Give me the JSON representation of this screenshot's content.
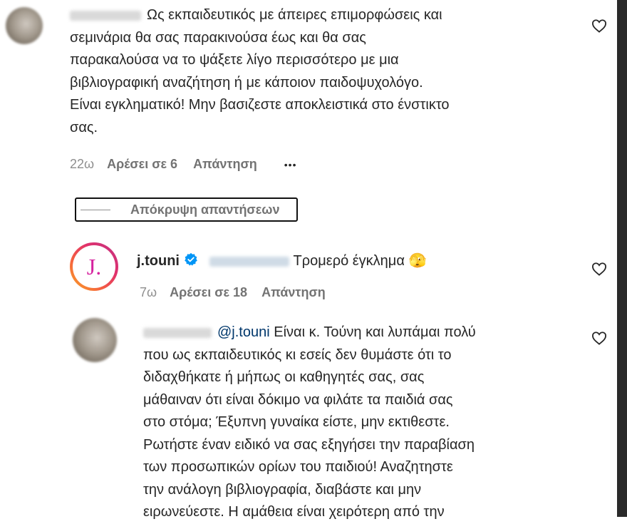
{
  "comment1": {
    "text_lines": [
      "Ως εκπαιδευτικός με άπειρες επιμορφώσεις και",
      "σεμινάρια θα σας παρακινούσα έως και θα σας",
      "παρακαλούσα να το ψάξετε λίγο περισσότερο με μια",
      "βιβλιογραφική αναζήτηση ή με κάποιον παιδοψυχολόγο.",
      "Είναι εγκληματικό! Μην βασιζεστε αποκλειστικά στο ένστικτο",
      "σας."
    ],
    "time": "22ω",
    "likes": "Αρέσει σε 6",
    "reply": "Απάντηση",
    "more": "•••"
  },
  "hide_replies_label": "Απόκρυψη απαντήσεων",
  "reply1": {
    "username": "j.touni",
    "avatar_letter": "J.",
    "text": "Τρομερό έγκλημα 🫣",
    "time": "7ω",
    "likes": "Αρέσει σε 18",
    "reply": "Απάντηση"
  },
  "reply2": {
    "mention": "@j.touni",
    "first_line_rest": " Είναι κ. Τούνη και λυπάμαι πολύ",
    "text_lines": [
      "που ως εκπαιδευτικός κι εσείς δεν θυμάστε ότι το",
      "διδαχθήκατε ή μήπως οι καθηγητές σας, σας",
      "μάθαιναν ότι είναι δόκιμο να φιλάτε τα παιδιά σας",
      "στο στόμα; Έξυπνη γυναίκα είστε, μην εκτιθεστε.",
      "Ρωτήστε έναν ειδικό να σας εξηγήσει την παραβίαση",
      "των προσωπικών ορίων του παιδιού! Αναζητηστε",
      "την ανάλογη βιβλιογραφία, διαβάστε και μην",
      "ειρωνεύεστε. Η αμάθεια είναι χειρότερη από την"
    ]
  },
  "colors": {
    "text": "#262626",
    "secondary": "#8e8e8e",
    "verified": "#0095f6",
    "mention": "#00376b",
    "avatar_ring_start": "#f9a825",
    "avatar_ring_end": "#c13584",
    "avatar_letter": "#d6249f"
  }
}
